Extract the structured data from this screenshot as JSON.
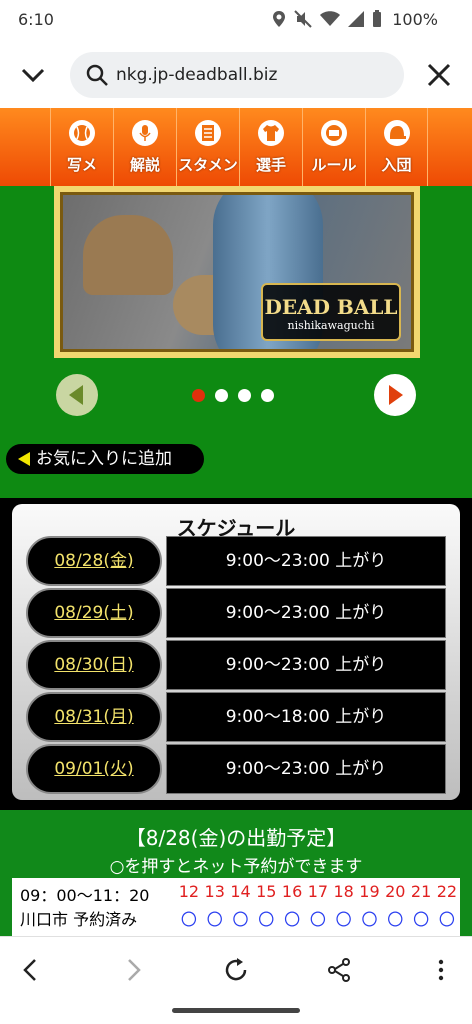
{
  "status": {
    "time": "6:10",
    "battery": "100%"
  },
  "browser": {
    "url": "nkg.jp-deadball.biz"
  },
  "nav": {
    "items": [
      {
        "label": "写メ",
        "icon": "baseball-icon"
      },
      {
        "label": "解説",
        "icon": "microphone-icon"
      },
      {
        "label": "スタメン",
        "icon": "document-icon"
      },
      {
        "label": "選手",
        "icon": "uniform-icon"
      },
      {
        "label": "ルール",
        "icon": "umpire-icon"
      },
      {
        "label": "入団",
        "icon": "cap-icon"
      }
    ]
  },
  "banner": {
    "logo_main": "DEAD BALL",
    "logo_sub": "nishikawaguchi",
    "slide_count": 4,
    "active_slide": 1
  },
  "favorite": {
    "label": "お気に入りに追加"
  },
  "schedule": {
    "title": "スケジュール",
    "rows": [
      {
        "date": "08/28(金)",
        "time": "9:00〜23:00 上がり"
      },
      {
        "date": "08/29(土)",
        "time": "9:00〜23:00 上がり"
      },
      {
        "date": "08/30(日)",
        "time": "9:00〜23:00 上がり"
      },
      {
        "date": "08/31(月)",
        "time": "9:00〜18:00 上がり"
      },
      {
        "date": "09/01(火)",
        "time": "9:00〜23:00 上がり"
      }
    ]
  },
  "attendance": {
    "title": "【8/28(金)の出勤予定】",
    "subtitle": "○を押すとネット予約ができます",
    "time_range": "09：00〜11：20",
    "location": "川口市 予約済み",
    "hours": [
      "12",
      "13",
      "14",
      "15",
      "16",
      "17",
      "18",
      "19",
      "20",
      "21",
      "22"
    ],
    "slot": "〇"
  },
  "colors": {
    "nav_orange": "#ff8a1e",
    "green": "#0e8a12",
    "accent_yellow": "#f2e26b"
  }
}
